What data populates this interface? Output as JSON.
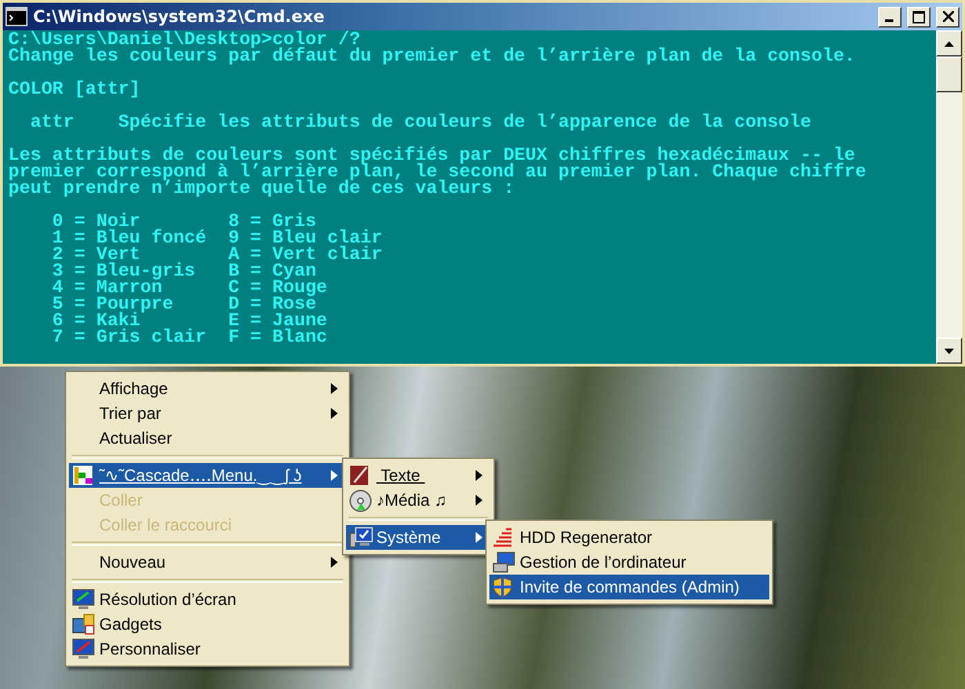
{
  "window": {
    "title": "C:\\Windows\\system32\\Cmd.exe"
  },
  "console": {
    "blocks": [
      [
        "C:\\Users\\Daniel\\Desktop>color /?",
        "Change les couleurs par défaut du premier et de l’arrière plan de la console."
      ],
      [
        "COLOR [attr]"
      ],
      [
        "  attr    Spécifie les attributs de couleurs de l’apparence de la console"
      ],
      [
        "Les attributs de couleurs sont spécifiés par DEUX chiffres hexadécimaux -- le",
        "premier correspond à l’arrière plan, le second au premier plan. Chaque chiffre",
        "peut prendre n’importe quelle de ces valeurs :"
      ],
      [
        "    0 = Noir        8 = Gris",
        "    1 = Bleu foncé  9 = Bleu clair",
        "    2 = Vert        A = Vert clair",
        "    3 = Bleu-gris   B = Cyan",
        "    4 = Marron      C = Rouge",
        "    5 = Pourpre     D = Rose",
        "    6 = Kaki        E = Jaune",
        "    7 = Gris clair  F = Blanc"
      ]
    ]
  },
  "context_menu": {
    "items": [
      {
        "kind": "item",
        "label": "Affichage",
        "submenu": true,
        "selected": false,
        "disabled": false
      },
      {
        "kind": "item",
        "label": "Trier par",
        "submenu": true,
        "selected": false,
        "disabled": false
      },
      {
        "kind": "item",
        "label": "Actualiser",
        "submenu": false,
        "selected": false,
        "disabled": false
      },
      {
        "kind": "separator"
      },
      {
        "kind": "icon_item",
        "label": "˜∿˜Cascade‥‥Menu.‿‿ʃ ʖ",
        "submenu": true,
        "selected": true,
        "disabled": false
      },
      {
        "kind": "item",
        "label": "Coller",
        "submenu": false,
        "selected": false,
        "disabled": true
      },
      {
        "kind": "item",
        "label": "Coller le raccourci",
        "submenu": false,
        "selected": false,
        "disabled": true
      },
      {
        "kind": "separator"
      },
      {
        "kind": "item",
        "label": "Nouveau",
        "submenu": true,
        "selected": false,
        "disabled": false
      },
      {
        "kind": "separator"
      },
      {
        "kind": "icon_item",
        "label": "Résolution d’écran",
        "submenu": false,
        "selected": false,
        "disabled": false
      },
      {
        "kind": "icon_item",
        "label": "Gadgets",
        "submenu": false,
        "selected": false,
        "disabled": false
      },
      {
        "kind": "icon_item",
        "label": "Personnaliser",
        "submenu": false,
        "selected": false,
        "disabled": false
      }
    ]
  },
  "cascade_menu": {
    "items": [
      {
        "kind": "icon_item",
        "label": " Texte ",
        "submenu": true,
        "selected": false,
        "disabled": false
      },
      {
        "kind": "icon_item",
        "label": "♪Média ♫",
        "submenu": true,
        "selected": false,
        "disabled": false
      },
      {
        "kind": "separator"
      },
      {
        "kind": "icon_item",
        "label": "Système",
        "submenu": true,
        "selected": true,
        "disabled": false
      }
    ]
  },
  "system_menu": {
    "items": [
      {
        "kind": "icon_item",
        "label": "HDD Regenerator",
        "submenu": false,
        "selected": false,
        "disabled": false
      },
      {
        "kind": "icon_item",
        "label": "Gestion de l’ordinateur",
        "submenu": false,
        "selected": false,
        "disabled": false
      },
      {
        "kind": "icon_item",
        "label": "Invite de commandes (Admin)",
        "submenu": false,
        "selected": true,
        "disabled": false
      }
    ]
  }
}
